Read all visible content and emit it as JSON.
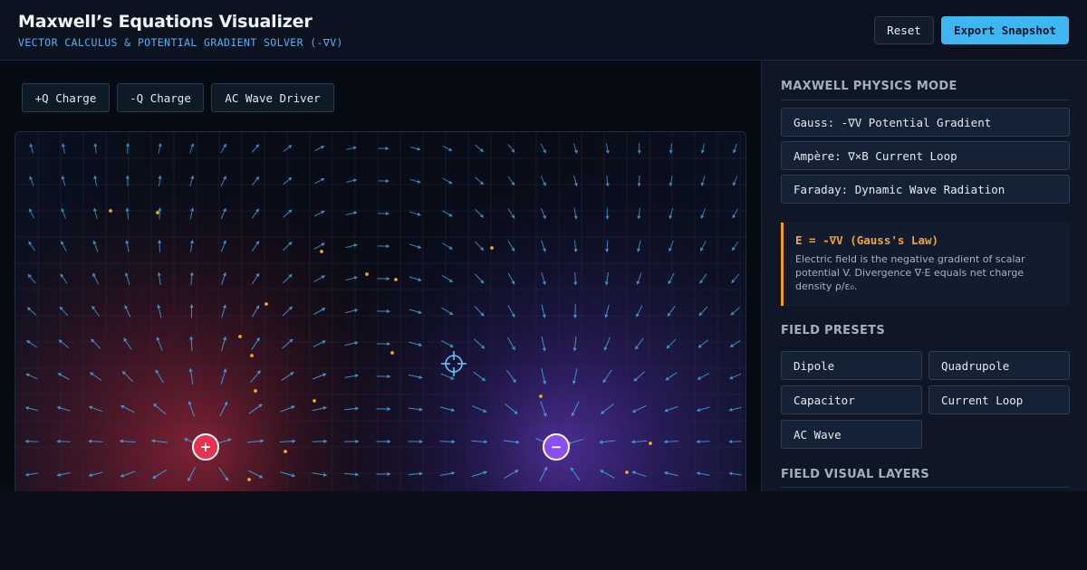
{
  "header": {
    "title": "Maxwell’s Equations Visualizer",
    "subtitle": "VECTOR CALCULUS & POTENTIAL GRADIENT SOLVER (-∇V)",
    "reset_label": "Reset",
    "export_label": "Export Snapshot"
  },
  "toolbar": {
    "tools": [
      {
        "label": "+Q Charge"
      },
      {
        "label": "-Q Charge"
      },
      {
        "label": "AC Wave Driver"
      }
    ]
  },
  "canvas": {
    "charges": [
      {
        "sign": "+",
        "color": "#e8324f"
      },
      {
        "sign": "−",
        "color": "#8a4ff0"
      }
    ],
    "icons": [
      "crosshair-icon",
      "plus-icon",
      "minus-icon"
    ],
    "colors": {
      "arrow": "#3f9fd8",
      "particle": "#f5a623",
      "positive_glow": "#d9344e",
      "negative_glow": "#7b45e8",
      "grid": "#2a3448"
    }
  },
  "sidebar": {
    "mode_title": "MAXWELL PHYSICS MODE",
    "modes": [
      {
        "label": "Gauss: -∇V Potential Gradient"
      },
      {
        "label": "Ampère: ∇×B Current Loop"
      },
      {
        "label": "Faraday: Dynamic Wave Radiation"
      }
    ],
    "info": {
      "title": "E = -∇V (Gauss's Law)",
      "body": "Electric field is the negative gradient of scalar potential V. Divergence ∇·E equals net charge density ρ/ε₀."
    },
    "presets_title": "FIELD PRESETS",
    "presets": [
      {
        "label": "Dipole"
      },
      {
        "label": "Quadrupole"
      },
      {
        "label": "Capacitor"
      },
      {
        "label": "Current Loop"
      },
      {
        "label": "AC Wave"
      }
    ],
    "layers_title": "FIELD VISUAL LAYERS",
    "accent": "#f39c1e"
  }
}
